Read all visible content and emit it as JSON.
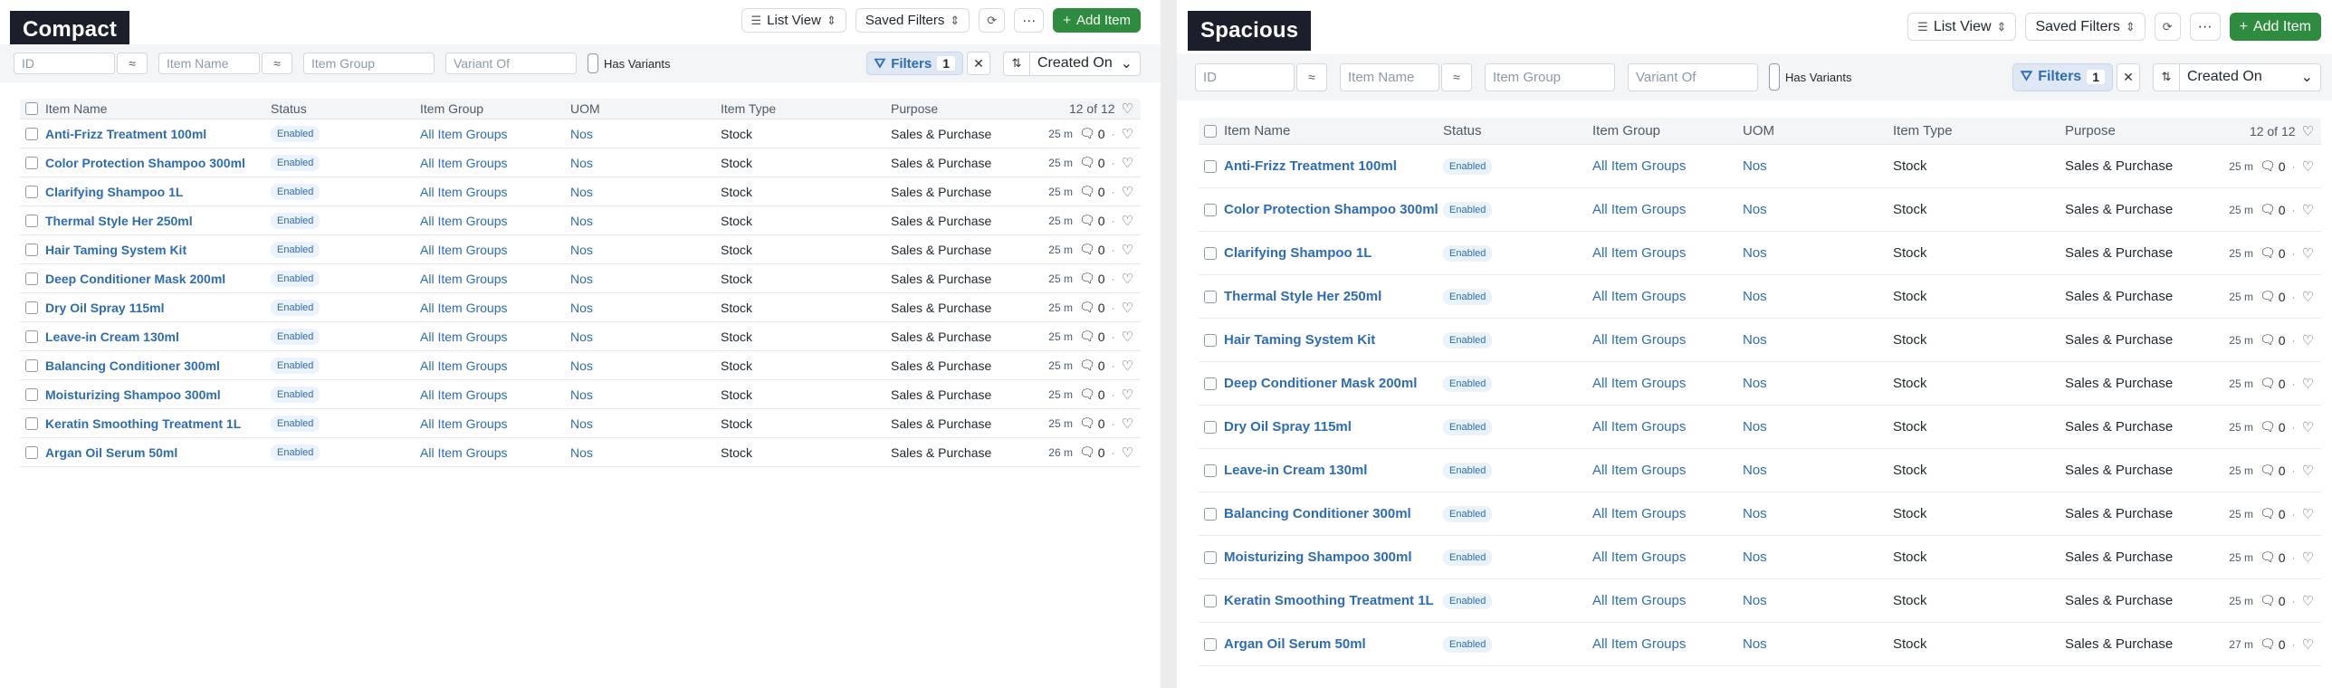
{
  "panels": [
    {
      "label": "Compact"
    },
    {
      "label": "Spacious"
    }
  ],
  "toolbar": {
    "list_view": "List View",
    "saved_filters": "Saved Filters",
    "more": "···",
    "add_item": "Add Item"
  },
  "filters": {
    "id_placeholder": "ID",
    "name_placeholder": "Item Name",
    "group_placeholder": "Item Group",
    "variant_placeholder": "Variant Of",
    "approx": "≈",
    "has_variants": "Has Variants",
    "filters_label": "Filters",
    "filters_count": "1",
    "clear": "✕",
    "sort_field": "Created On"
  },
  "table": {
    "columns": [
      "Item Name",
      "Status",
      "Item Group",
      "UOM",
      "Item Type",
      "Purpose"
    ],
    "count": "12 of 12",
    "rows": [
      {
        "name": "Anti-Frizz Treatment 100ml",
        "status": "Enabled",
        "group": "All Item Groups",
        "uom": "Nos",
        "type": "Stock",
        "purpose": "Sales & Purchase",
        "time_compact": "25 m",
        "time_spacious": "25 m",
        "comments": "0"
      },
      {
        "name": "Color Protection Shampoo 300ml",
        "status": "Enabled",
        "group": "All Item Groups",
        "uom": "Nos",
        "type": "Stock",
        "purpose": "Sales & Purchase",
        "time_compact": "25 m",
        "time_spacious": "25 m",
        "comments": "0"
      },
      {
        "name": "Clarifying Shampoo 1L",
        "status": "Enabled",
        "group": "All Item Groups",
        "uom": "Nos",
        "type": "Stock",
        "purpose": "Sales & Purchase",
        "time_compact": "25 m",
        "time_spacious": "25 m",
        "comments": "0"
      },
      {
        "name": "Thermal Style Her 250ml",
        "status": "Enabled",
        "group": "All Item Groups",
        "uom": "Nos",
        "type": "Stock",
        "purpose": "Sales & Purchase",
        "time_compact": "25 m",
        "time_spacious": "25 m",
        "comments": "0"
      },
      {
        "name": "Hair Taming System Kit",
        "status": "Enabled",
        "group": "All Item Groups",
        "uom": "Nos",
        "type": "Stock",
        "purpose": "Sales & Purchase",
        "time_compact": "25 m",
        "time_spacious": "25 m",
        "comments": "0"
      },
      {
        "name": "Deep Conditioner Mask 200ml",
        "status": "Enabled",
        "group": "All Item Groups",
        "uom": "Nos",
        "type": "Stock",
        "purpose": "Sales & Purchase",
        "time_compact": "25 m",
        "time_spacious": "25 m",
        "comments": "0"
      },
      {
        "name": "Dry Oil Spray 115ml",
        "status": "Enabled",
        "group": "All Item Groups",
        "uom": "Nos",
        "type": "Stock",
        "purpose": "Sales & Purchase",
        "time_compact": "25 m",
        "time_spacious": "25 m",
        "comments": "0"
      },
      {
        "name": "Leave-in Cream 130ml",
        "status": "Enabled",
        "group": "All Item Groups",
        "uom": "Nos",
        "type": "Stock",
        "purpose": "Sales & Purchase",
        "time_compact": "25 m",
        "time_spacious": "25 m",
        "comments": "0"
      },
      {
        "name": "Balancing Conditioner 300ml",
        "status": "Enabled",
        "group": "All Item Groups",
        "uom": "Nos",
        "type": "Stock",
        "purpose": "Sales & Purchase",
        "time_compact": "25 m",
        "time_spacious": "25 m",
        "comments": "0"
      },
      {
        "name": "Moisturizing Shampoo 300ml",
        "status": "Enabled",
        "group": "All Item Groups",
        "uom": "Nos",
        "type": "Stock",
        "purpose": "Sales & Purchase",
        "time_compact": "25 m",
        "time_spacious": "25 m",
        "comments": "0"
      },
      {
        "name": "Keratin Smoothing Treatment 1L",
        "status": "Enabled",
        "group": "All Item Groups",
        "uom": "Nos",
        "type": "Stock",
        "purpose": "Sales & Purchase",
        "time_compact": "25 m",
        "time_spacious": "25 m",
        "comments": "0"
      },
      {
        "name": "Argan Oil Serum 50ml",
        "status": "Enabled",
        "group": "All Item Groups",
        "uom": "Nos",
        "type": "Stock",
        "purpose": "Sales & Purchase",
        "time_compact": "26 m",
        "time_spacious": "27 m",
        "comments": "0"
      }
    ]
  },
  "colors": {
    "primary": "#2e8c3f",
    "link": "#2d6cb3",
    "label_bg": "#1a1f2b"
  }
}
